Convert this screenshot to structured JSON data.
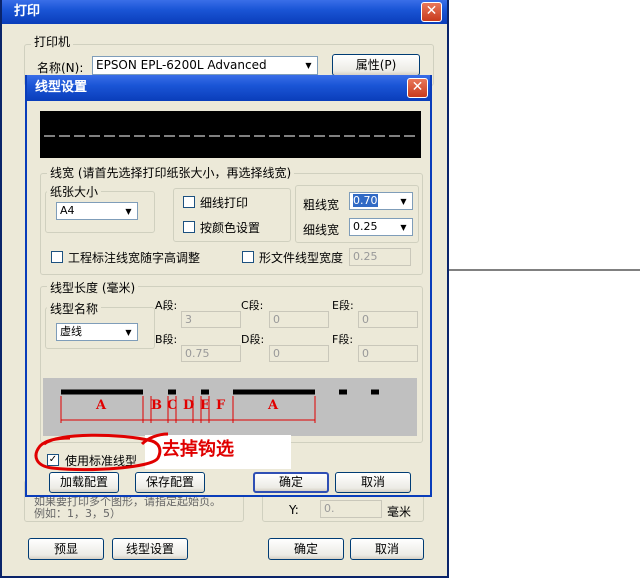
{
  "print_dialog": {
    "title": "打印",
    "printer_group": "打印机",
    "name_label": "名称(N):",
    "printer_name": "EPSON EPL-6200L Advanced",
    "properties_button": "属性(P)",
    "partial_text_1": "如果要打印多个图形，请指定起始页。",
    "partial_text_2": "例如：1，3，5）",
    "y_label": "Y:",
    "y_value": "0.",
    "unit_mm": "毫米",
    "preview_button": "预显",
    "linetype_settings_button": "线型设置",
    "ok_button": "确定",
    "cancel_button": "取消"
  },
  "linetype_dialog": {
    "title": "线型设置",
    "width_group": "线宽 (请首先选择打印纸张大小，再选择线宽)",
    "paper_size_group": "纸张大小",
    "paper_size_value": "A4",
    "thin_print_label": "细线打印",
    "by_color_label": "按颜色设置",
    "thick_label": "粗线宽",
    "thick_value": "0.70",
    "thin_label": "细线宽",
    "thin_value": "0.25",
    "annotation_adjust_label": "工程标注线宽随字高调整",
    "shape_file_label": "形文件线型宽度",
    "shape_file_value": "0.25",
    "length_group": "线型长度 (毫米)",
    "linetype_name_group": "线型名称",
    "linetype_name_value": "虚线",
    "segments": {
      "a_label": "A段:",
      "a_value": "3",
      "b_label": "B段:",
      "b_value": "0.75",
      "c_label": "C段:",
      "c_value": "0",
      "d_label": "D段:",
      "d_value": "0",
      "e_label": "E段:",
      "e_value": "0",
      "f_label": "F段:",
      "f_value": "0"
    },
    "diagram_labels": [
      "A",
      "B",
      "C",
      "D",
      "E",
      "F",
      "A"
    ],
    "use_standard_label": "使用标准线型",
    "use_standard_checked": true,
    "load_config_button": "加载配置",
    "save_config_button": "保存配置",
    "ok_button": "确定",
    "cancel_button": "取消"
  },
  "annotation": {
    "text": "去掉钩选",
    "color": "#e00000"
  },
  "colors": {
    "titlebar": "#0a3dba",
    "window_bg": "#ece9d8",
    "selection": "#316ac5"
  }
}
